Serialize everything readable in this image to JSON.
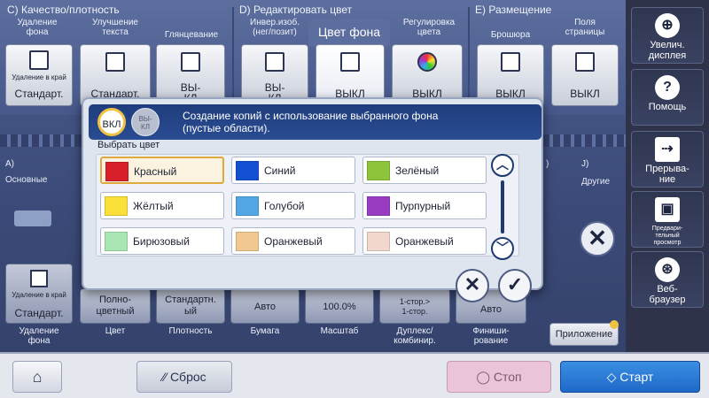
{
  "sections": {
    "quality": "C)  Качество/плотность",
    "edit": "D)  Редактировать цвет",
    "layout": "E)  Размещение"
  },
  "top_buttons": [
    {
      "label": "Удаление\nфона",
      "value": "Стандарт.",
      "small": "Удаление в край"
    },
    {
      "label": "Улучшение\nтекста",
      "value": "Стандарт."
    },
    {
      "label": "Глянцевание",
      "value": "ВЫ-\nКЛ"
    },
    {
      "label": "Инвер.изоб.\n(нег/позит)",
      "value": "ВЫ-\nКЛ"
    },
    {
      "label": "Цвет фона",
      "value": "ВЫКЛ"
    },
    {
      "label": "Регулировка\nцвета",
      "value": "ВЫКЛ"
    },
    {
      "label": "Брошюра",
      "value": "ВЫКЛ"
    },
    {
      "label": "Поля\nстраницы",
      "value": "ВЫКЛ"
    }
  ],
  "mid": {
    "a_label": "A)",
    "basic": "Основные",
    "j_label": "J)",
    "other": "Другие",
    "i_label": ")"
  },
  "bottom_buttons": [
    {
      "value": "Стандарт.",
      "small": "Удаление в край",
      "label": "Удаление\nфона"
    },
    {
      "value": "Полно-\nцветный",
      "label": "Цвет"
    },
    {
      "value": "Стандартн.\nый",
      "label": "Плотность"
    },
    {
      "value": "Авто",
      "label": "Бумага"
    },
    {
      "value": "100.0%",
      "label": "Масштаб"
    },
    {
      "value": "1-стор.>\n1-стор.",
      "label": "Дуплекс/\nкомбинир."
    },
    {
      "value": "Авто",
      "label": "Финиши-\nрование"
    }
  ],
  "dialog": {
    "toggle_on": "ВКЛ",
    "toggle_off": "ВЫ-\nКЛ",
    "description": "Создание копий с использование выбранного фона\n(пустые области).",
    "select_label": "Выбрать цвет",
    "colors": [
      {
        "name": "Красный",
        "hex": "#d8202a",
        "selected": true
      },
      {
        "name": "Синий",
        "hex": "#1450d2"
      },
      {
        "name": "Зелёный",
        "hex": "#8cc43c"
      },
      {
        "name": "Жёлтый",
        "hex": "#fae038"
      },
      {
        "name": "Голубой",
        "hex": "#52a6e4"
      },
      {
        "name": "Пурпурный",
        "hex": "#9a3cc2"
      },
      {
        "name": "Бирюзовый",
        "hex": "#a8e6b4"
      },
      {
        "name": "Оранжевый",
        "hex": "#f0c890"
      },
      {
        "name": "Оранжевый",
        "hex": "#f2d8cc"
      }
    ]
  },
  "sidebar": [
    {
      "label": "Увелич.\nдисплея",
      "icon": "zoom-icon"
    },
    {
      "label": "Помощь",
      "icon": "help-icon"
    },
    {
      "label": "Прерыва-\nние",
      "icon": "interrupt-icon"
    },
    {
      "label": "Предвари-\nтельный\nпросмотр",
      "icon": "preview-icon"
    },
    {
      "label": "Веб-\nбраузер",
      "icon": "globe-icon"
    }
  ],
  "app_button": "Приложение",
  "bottom_bar": {
    "reset": "Сброс",
    "stop": "Стоп",
    "start": "Старт"
  },
  "colors": {
    "accent": "#1f68c9",
    "stop": "#eac4d8",
    "start": "#2a7ed2",
    "highlight": "#f0c242"
  }
}
